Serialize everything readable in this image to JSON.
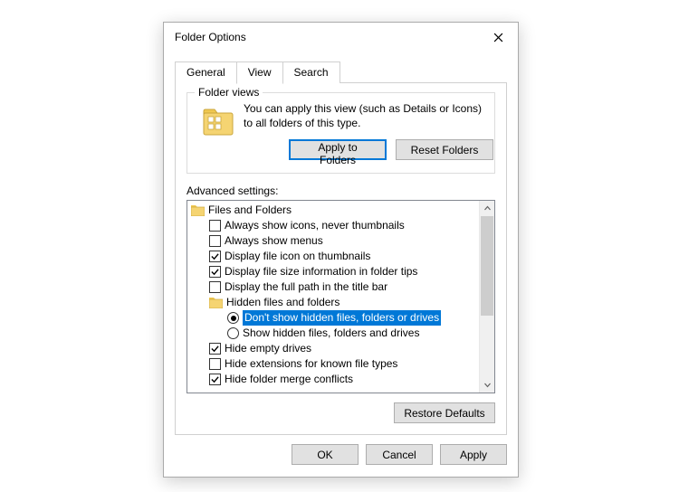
{
  "window": {
    "title": "Folder Options"
  },
  "tabs": {
    "general": "General",
    "view": "View",
    "search": "Search"
  },
  "folder_views": {
    "legend": "Folder views",
    "desc": "You can apply this view (such as Details or Icons) to all folders of this type.",
    "apply_btn": "Apply to Folders",
    "reset_btn": "Reset Folders"
  },
  "advanced": {
    "label": "Advanced settings:",
    "root": "Files and Folders",
    "items": {
      "always_icons": "Always show icons, never thumbnails",
      "always_menus": "Always show menus",
      "file_icon_thumb": "Display file icon on thumbnails",
      "file_size_tips": "Display file size information in folder tips",
      "full_path_title": "Display the full path in the title bar",
      "hidden_group": "Hidden files and folders",
      "dont_show_hidden": "Don't show hidden files, folders or drives",
      "show_hidden": "Show hidden files, folders and drives",
      "hide_empty": "Hide empty drives",
      "hide_ext": "Hide extensions for known file types",
      "hide_merge": "Hide folder merge conflicts"
    },
    "restore_btn": "Restore Defaults"
  },
  "buttons": {
    "ok": "OK",
    "cancel": "Cancel",
    "apply": "Apply"
  }
}
